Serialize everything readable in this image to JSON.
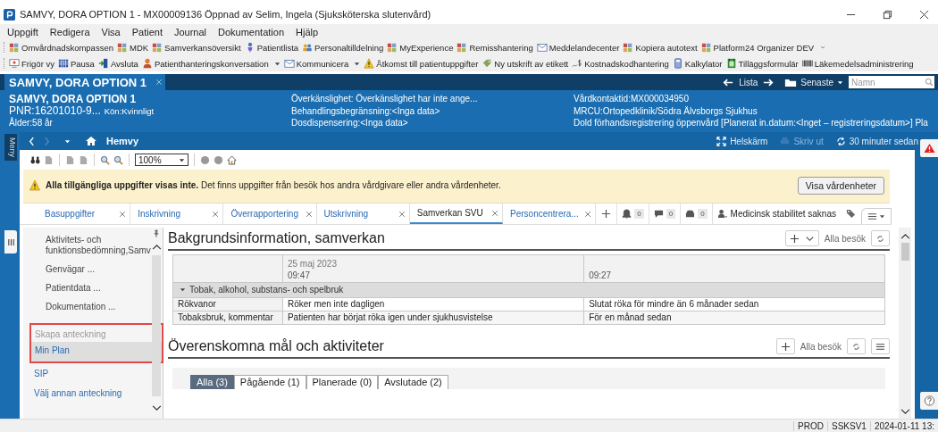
{
  "window": {
    "title": "SAMVY, DORA OPTION 1 - MX00009136 Öppnad av Selim, Ingela (Sjuksköterska slutenvård)"
  },
  "menu": [
    "Uppgift",
    "Redigera",
    "Visa",
    "Patient",
    "Journal",
    "Dokumentation",
    "Hjälp"
  ],
  "toolbar_1": [
    "Omvårdnadskompassen",
    "MDK",
    "Samverkansöversikt",
    "Patientlista",
    "Personaltilldelning",
    "MyExperience",
    "Remisshantering",
    "Meddelandecenter",
    "Kopiera autotext",
    "Platform24 Organizer DEV"
  ],
  "toolbar_2": [
    {
      "label": "Frigör vy",
      "dropdown": false
    },
    {
      "label": "Pausa",
      "dropdown": false
    },
    {
      "label": "Avsluta",
      "dropdown": false
    },
    {
      "label": "Patienthanteringskonversation",
      "dropdown": true
    },
    {
      "label": "Kommunicera",
      "dropdown": true
    },
    {
      "label": "Åtkomst till patientuppgifter",
      "dropdown": false
    },
    {
      "label": "Ny utskrift av etikett",
      "dropdown": false
    },
    {
      "label": "Kostnadskodhantering",
      "dropdown": false
    },
    {
      "label": "Kalkylator",
      "dropdown": false
    },
    {
      "label": "Tilläggsformulär",
      "dropdown": false
    },
    {
      "label": "Läkemedelsadministrering",
      "dropdown": false
    }
  ],
  "patient_tab": {
    "label": "SAMVY, DORA OPTION 1"
  },
  "top_nav": {
    "list_label": "Lista",
    "recent_label": "Senaste",
    "search_placeholder": "Namn"
  },
  "banner": {
    "name": "SAMVY, DORA OPTION 1",
    "pnr": "PNR:16201010-9...",
    "gender": "Kön:Kvinnligt",
    "age": "Ålder:58 år",
    "column_2": [
      "Överkänslighet: Överkänslighet har inte ange...",
      "Behandlingsbegränsning:<Inga data>",
      "Dosdispensering:<Inga data>"
    ],
    "column_3": [
      "Vårdkontaktid:MX000034950",
      "MRCU:Ortopedklinik/Södra Älvsborgs Sjukhus",
      "Dold förhandsregistrering öppenvård [Planerat in.datum:<Inget – registreringsdatum>] Pla"
    ]
  },
  "side_strip": {
    "label": "Meny"
  },
  "nav": {
    "forward_disabled": true,
    "home_label": "Hemvy",
    "fullscreen_label": "Helskärm",
    "print": {
      "label": "Skriv ut",
      "disabled": true
    },
    "refreshed": "30 minuter sedan"
  },
  "doc_toolbar": {
    "zoom": "100%"
  },
  "notice": {
    "text": "**Alla tillgängliga uppgifter visas inte.** Det finns uppgifter från besök hos andra vårdgivare eller andra vårdenheter.",
    "button": "Visa vårdenheter"
  },
  "tabs": [
    {
      "label": "Basuppgifter",
      "selected": false
    },
    {
      "label": "Inskrivning",
      "selected": false
    },
    {
      "label": "Överrapportering",
      "selected": false
    },
    {
      "label": "Utskrivning",
      "selected": false
    },
    {
      "label": "Samverkan SVU",
      "selected": true
    },
    {
      "label": "Personcentrera...",
      "selected": false
    }
  ],
  "tab_tools": {
    "counters": [
      "0",
      "0",
      "0"
    ],
    "status": "Medicinsk stabilitet saknas"
  },
  "side_panel": {
    "items": [
      {
        "kind": "item",
        "label": "Aktivitets- och funktionsbedömning,Samv",
        "selected": false
      },
      {
        "kind": "item",
        "label": "Genvägar ...",
        "selected": false
      },
      {
        "kind": "item",
        "label": "Patientdata ...",
        "selected": false
      },
      {
        "kind": "item",
        "label": "Dokumentation ...",
        "selected": false
      },
      {
        "kind": "header",
        "label": "Skapa anteckning"
      },
      {
        "kind": "link",
        "label": "Min Plan",
        "selected": true
      },
      {
        "kind": "link",
        "label": "SIP",
        "selected": false
      },
      {
        "kind": "link",
        "label": "Välj annan anteckning",
        "selected": false
      }
    ]
  },
  "sections": [
    {
      "title": "Bakgrundsinformation, samverkan",
      "add_dropdown": true,
      "has_menu": false,
      "filter": "Alla besök",
      "table": {
        "columns": [
          {
            "date": "25 maj 2023",
            "time": "09:47"
          },
          {
            "time": "09:27"
          }
        ],
        "groups": [
          {
            "label": "Tobak, alkohol, substans- och spelbruk",
            "expanded": true,
            "rows": [
              {
                "label": "Rökvanor",
                "values": [
                  "Röker men inte dagligen",
                  "Slutat röka för mindre än 6 månader sedan"
                ]
              },
              {
                "label": "Tobaksbruk, kommentar",
                "values": [
                  "Patienten har börjat röka igen under sjukhusvistelse",
                  "För en månad sedan"
                ]
              }
            ]
          }
        ]
      }
    },
    {
      "title": "Överenskomna mål och aktiviteter",
      "add_dropdown": false,
      "has_menu": true,
      "filter": "Alla besök",
      "filter_tabs": [
        {
          "label": "Alla (3)",
          "selected": true
        },
        {
          "label": "Pågående (1)",
          "selected": false
        },
        {
          "label": "Planerade (0)",
          "selected": false
        },
        {
          "label": "Avslutade (2)",
          "selected": false
        }
      ]
    }
  ],
  "status_bar": [
    "PROD",
    "SSKSV1",
    "2024-01-11 13:"
  ]
}
